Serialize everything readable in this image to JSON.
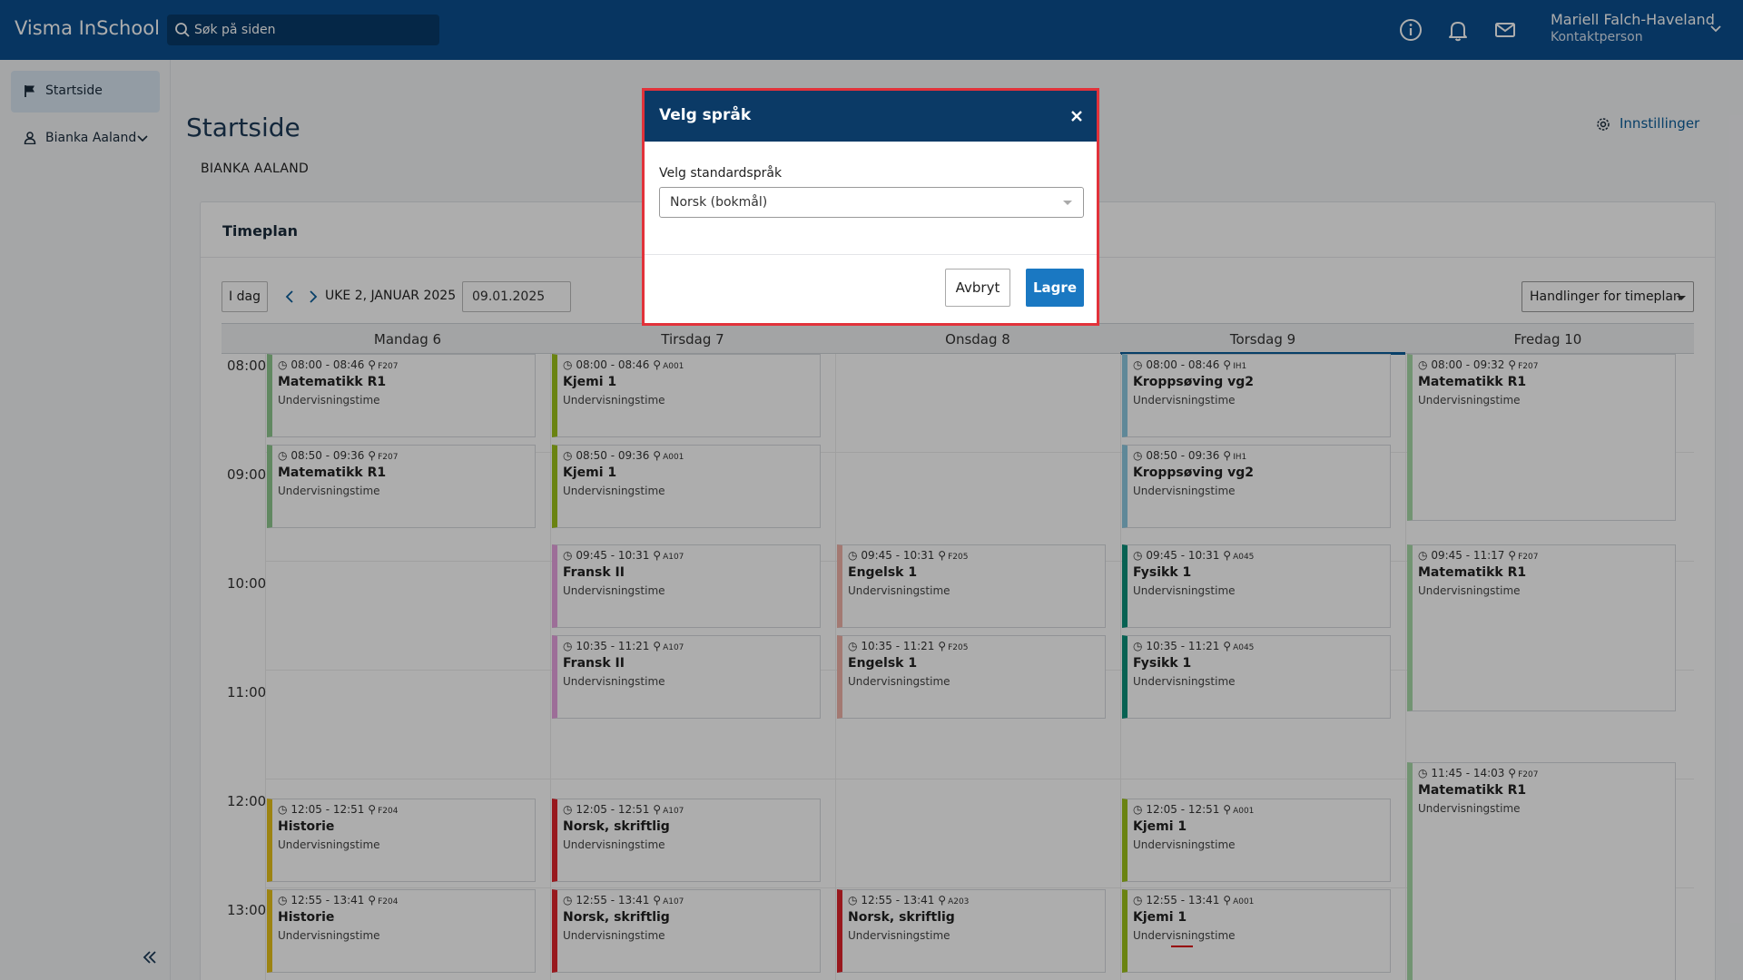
{
  "app": {
    "brand": "Visma InSchool"
  },
  "search": {
    "placeholder": "Søk på siden"
  },
  "topbar": {
    "icons": [
      "info-icon",
      "bell-icon",
      "mail-icon"
    ],
    "user_name": "Mariell Falch-Haveland",
    "user_role": "Kontaktperson"
  },
  "sidebar": {
    "items": [
      {
        "label": "Startside",
        "icon": "flag-icon",
        "active": true
      },
      {
        "label": "Bianka Aaland",
        "icon": "student-icon",
        "active": false
      }
    ]
  },
  "page": {
    "title": "Startside",
    "settings_label": "Innstillinger",
    "student_name": "BIANKA AALAND"
  },
  "timetable": {
    "title": "Timeplan",
    "today_button": "I dag",
    "week_label": "UKE 2, JANUAR 2025",
    "date_value": "09.01.2025",
    "actions_button": "Handlinger for timeplan",
    "days": [
      "Mandag 6",
      "Tirsdag 7",
      "Onsdag 8",
      "Torsdag 9",
      "Fredag 10"
    ],
    "hours": [
      "08:00",
      "09:00",
      "10:00",
      "11:00",
      "12:00",
      "13:00"
    ],
    "lessons": [
      {
        "day": 0,
        "time": "08:00 - 08:46",
        "room": "F207",
        "subject": "Matematikk R1",
        "type": "Undervisningstime",
        "color": "#8fc98f"
      },
      {
        "day": 0,
        "time": "08:50 - 09:36",
        "room": "F207",
        "subject": "Matematikk R1",
        "type": "Undervisningstime",
        "color": "#8fc98f"
      },
      {
        "day": 0,
        "time": "12:05 - 12:51",
        "room": "F204",
        "subject": "Historie",
        "type": "Undervisningstime",
        "color": "#e6c21a"
      },
      {
        "day": 0,
        "time": "12:55 - 13:41",
        "room": "F204",
        "subject": "Historie",
        "type": "Undervisningstime",
        "color": "#e6c21a"
      },
      {
        "day": 1,
        "time": "08:00 - 08:46",
        "room": "A001",
        "subject": "Kjemi 1",
        "type": "Undervisningstime",
        "color": "#9cc21a"
      },
      {
        "day": 1,
        "time": "08:50 - 09:36",
        "room": "A001",
        "subject": "Kjemi 1",
        "type": "Undervisningstime",
        "color": "#9cc21a"
      },
      {
        "day": 1,
        "time": "09:45 - 10:31",
        "room": "A107",
        "subject": "Fransk II",
        "type": "Undervisningstime",
        "color": "#e7a2e0"
      },
      {
        "day": 1,
        "time": "10:35 - 11:21",
        "room": "A107",
        "subject": "Fransk II",
        "type": "Undervisningstime",
        "color": "#e7a2e0"
      },
      {
        "day": 1,
        "time": "12:05 - 12:51",
        "room": "A107",
        "subject": "Norsk, skriftlig",
        "type": "Undervisningstime",
        "color": "#e0242c"
      },
      {
        "day": 1,
        "time": "12:55 - 13:41",
        "room": "A107",
        "subject": "Norsk, skriftlig",
        "type": "Undervisningstime",
        "color": "#e0242c"
      },
      {
        "day": 2,
        "time": "09:45 - 10:31",
        "room": "F205",
        "subject": "Engelsk 1",
        "type": "Undervisningstime",
        "color": "#f0b3a8"
      },
      {
        "day": 2,
        "time": "10:35 - 11:21",
        "room": "F205",
        "subject": "Engelsk 1",
        "type": "Undervisningstime",
        "color": "#f0b3a8"
      },
      {
        "day": 2,
        "time": "12:55 - 13:41",
        "room": "A203",
        "subject": "Norsk, skriftlig",
        "type": "Undervisningstime",
        "color": "#e0242c"
      },
      {
        "day": 3,
        "time": "08:00 - 08:46",
        "room": "IH1",
        "subject": "Kroppsøving vg2",
        "type": "Undervisningstime",
        "color": "#8cc9e0"
      },
      {
        "day": 3,
        "time": "08:50 - 09:36",
        "room": "IH1",
        "subject": "Kroppsøving vg2",
        "type": "Undervisningstime",
        "color": "#8cc9e0"
      },
      {
        "day": 3,
        "time": "09:45 - 10:31",
        "room": "A045",
        "subject": "Fysikk 1",
        "type": "Undervisningstime",
        "color": "#0a8f7a"
      },
      {
        "day": 3,
        "time": "10:35 - 11:21",
        "room": "A045",
        "subject": "Fysikk 1",
        "type": "Undervisningstime",
        "color": "#0a8f7a"
      },
      {
        "day": 3,
        "time": "12:05 - 12:51",
        "room": "A001",
        "subject": "Kjemi 1",
        "type": "Undervisningstime",
        "color": "#9cc21a"
      },
      {
        "day": 3,
        "time": "12:55 - 13:41",
        "room": "A001",
        "subject": "Kjemi 1",
        "type": "Undervisningstime",
        "color": "#9cc21a"
      },
      {
        "day": 4,
        "time": "08:00 - 09:32",
        "room": "F207",
        "subject": "Matematikk R1",
        "type": "Undervisningstime",
        "color": "#a8dba8"
      },
      {
        "day": 4,
        "time": "09:45 - 11:17",
        "room": "F207",
        "subject": "Matematikk R1",
        "type": "Undervisningstime",
        "color": "#a8dba8"
      },
      {
        "day": 4,
        "time": "11:45 - 14:03",
        "room": "F207",
        "subject": "Matematikk R1",
        "type": "Undervisningstime",
        "color": "#a8dba8"
      }
    ]
  },
  "modal": {
    "title": "Velg språk",
    "field_label": "Velg standardspråk",
    "selected_value": "Norsk (bokmål)",
    "cancel_label": "Avbryt",
    "save_label": "Lagre"
  }
}
